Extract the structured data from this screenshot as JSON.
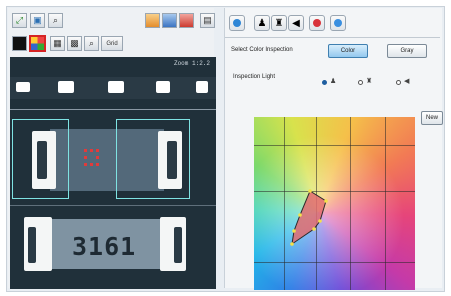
{
  "viewer": {
    "zoom_label": "Zoom 1:2.2",
    "component_marking": "3161"
  },
  "toolbar": {
    "icons": [
      "fit-icon",
      "image-icon",
      "zoom-icon",
      "layer-orange-icon",
      "layer-blue-icon",
      "layer-red-icon",
      "save-icon",
      "black-square-icon",
      "color-grid-icon",
      "pattern-icon",
      "checker-icon",
      "zoom-window-icon",
      "grid-icon"
    ],
    "grid_button_label": "Grid"
  },
  "inspection": {
    "select_label": "Select Color Inspection",
    "color_button": "Color",
    "gray_button": "Gray",
    "light_label": "Inspection Light",
    "light_options": [
      "ring-light-icon",
      "coaxial-light-icon",
      "side-light-icon"
    ],
    "selected_light": 0,
    "new_button": "New"
  },
  "colors": {
    "accent": "#3f7fb0",
    "selected_tool_border": "#d62424",
    "roi_box": "#7fe3e3",
    "marker": "#e23a3a"
  }
}
